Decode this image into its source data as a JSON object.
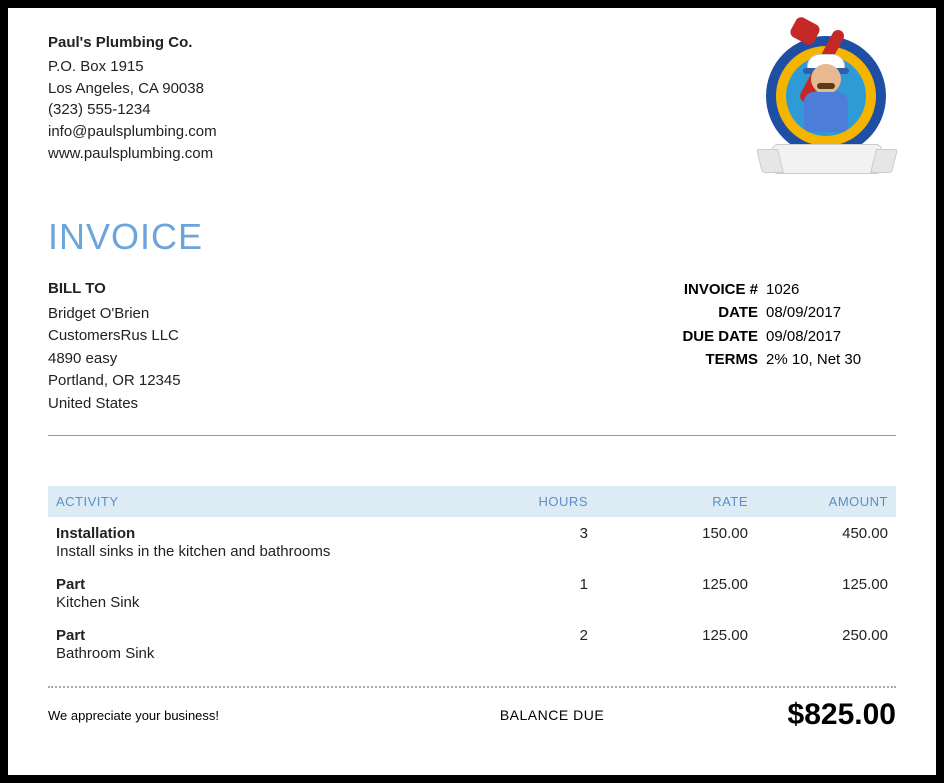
{
  "company": {
    "name": "Paul's Plumbing Co.",
    "pobox": "P.O. Box 1915",
    "city_line": "Los Angeles, CA  90038",
    "phone": "(323) 555-1234",
    "email": "info@paulsplumbing.com",
    "website": "www.paulsplumbing.com"
  },
  "document_title": "INVOICE",
  "bill_to": {
    "label": "BILL TO",
    "name": "Bridget O'Brien",
    "company": "CustomersRus LLC",
    "street": "4890 easy",
    "city_line": "Portland, OR  12345",
    "country": "United States"
  },
  "meta": {
    "invoice_label": "INVOICE #",
    "invoice_number": "1026",
    "date_label": "DATE",
    "date": "08/09/2017",
    "due_label": "DUE DATE",
    "due_date": "09/08/2017",
    "terms_label": "TERMS",
    "terms": "2% 10, Net 30"
  },
  "table": {
    "headers": {
      "activity": "ACTIVITY",
      "hours": "HOURS",
      "rate": "RATE",
      "amount": "AMOUNT"
    },
    "rows": [
      {
        "name": "Installation",
        "desc": "Install sinks in the kitchen and bathrooms",
        "hours": "3",
        "rate": "150.00",
        "amount": "450.00"
      },
      {
        "name": "Part",
        "desc": "Kitchen Sink",
        "hours": "1",
        "rate": "125.00",
        "amount": "125.00"
      },
      {
        "name": "Part",
        "desc": "Bathroom Sink",
        "hours": "2",
        "rate": "125.00",
        "amount": "250.00"
      }
    ]
  },
  "footer": {
    "thanks": "We appreciate your business!",
    "balance_label": "BALANCE DUE",
    "balance_amount": "$825.00"
  }
}
